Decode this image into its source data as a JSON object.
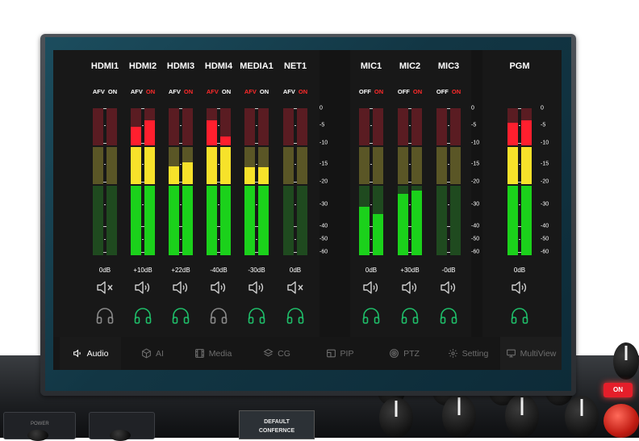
{
  "channels": [
    {
      "name": "HDMI1",
      "t1": "AFV",
      "t1_color": "#ffffff",
      "t2": "ON",
      "t2_color": "#ffffff",
      "db": "0dB",
      "speaker": "speaker-muted-icon",
      "headphone_color": "#8a8a8a",
      "level_l": 0,
      "level_r": 0
    },
    {
      "name": "HDMI2",
      "t1": "AFV",
      "t1_color": "#ffffff",
      "t2": "ON",
      "t2_color": "#ff2a2a",
      "db": "+10dB",
      "speaker": "speaker-on-icon",
      "headphone_color": "#1fbf6a",
      "level_l": 0.875,
      "level_r": 0.918
    },
    {
      "name": "HDMI3",
      "t1": "AFV",
      "t1_color": "#ffffff",
      "t2": "ON",
      "t2_color": "#ff2a2a",
      "db": "+22dB",
      "speaker": "speaker-on-icon",
      "headphone_color": "#1fbf6a",
      "level_l": 0.606,
      "level_r": 0.632
    },
    {
      "name": "HDMI4",
      "t1": "AFV",
      "t1_color": "#ff2a2a",
      "t2": "ON",
      "t2_color": "#ffffff",
      "db": "-40dB",
      "speaker": "speaker-on-icon",
      "headphone_color": "#8a8a8a",
      "level_l": 0.917,
      "level_r": 0.81
    },
    {
      "name": "MEDIA1",
      "t1": "AFV",
      "t1_color": "#ff2a2a",
      "t2": "ON",
      "t2_color": "#ffffff",
      "db": "-30dB",
      "speaker": "speaker-on-icon",
      "headphone_color": "#1fbf6a",
      "level_l": 0.6,
      "level_r": 0.6
    },
    {
      "name": "NET1",
      "t1": "AFV",
      "t1_color": "#ffffff",
      "t2": "ON",
      "t2_color": "#ff2a2a",
      "db": "0dB",
      "speaker": "speaker-muted-icon",
      "headphone_color": "#1fbf6a",
      "level_l": 0,
      "level_r": 0
    },
    {
      "name": "MIC1",
      "t1": "OFF",
      "t1_color": "#ffffff",
      "t2": "ON",
      "t2_color": "#ff2a2a",
      "db": "0dB",
      "speaker": "speaker-on-icon",
      "headphone_color": "#1fbf6a",
      "level_l": 0.33,
      "level_r": 0.28
    },
    {
      "name": "MIC2",
      "t1": "OFF",
      "t1_color": "#ffffff",
      "t2": "ON",
      "t2_color": "#ff2a2a",
      "db": "+30dB",
      "speaker": "speaker-on-icon",
      "headphone_color": "#1fbf6a",
      "level_l": 0.42,
      "level_r": 0.44
    },
    {
      "name": "MIC3",
      "t1": "OFF",
      "t1_color": "#ffffff",
      "t2": "ON",
      "t2_color": "#ff2a2a",
      "db": "-0dB",
      "speaker": "speaker-on-icon",
      "headphone_color": "#1fbf6a",
      "level_l": 0,
      "level_r": 0
    },
    {
      "name": "PGM",
      "t1": "",
      "t1_color": "#ffffff",
      "t2": "",
      "t2_color": "#ffffff",
      "db": "0dB",
      "speaker": "speaker-on-icon",
      "headphone_color": "#1fbf6a",
      "level_l": 0.9,
      "level_r": 0.918
    }
  ],
  "scale_labels": [
    "0",
    "-5",
    "-10",
    "-15",
    "-20",
    "-30",
    "-40",
    "-50",
    "-60"
  ],
  "tabs": [
    {
      "label": "Audio",
      "icon": "speaker-icon",
      "active": true
    },
    {
      "label": "AI",
      "icon": "cube-icon",
      "active": false
    },
    {
      "label": "Media",
      "icon": "film-icon",
      "active": false
    },
    {
      "label": "CG",
      "icon": "layers-icon",
      "active": false
    },
    {
      "label": "PIP",
      "icon": "pip-icon",
      "active": false
    },
    {
      "label": "PTZ",
      "icon": "target-icon",
      "active": false
    },
    {
      "label": "Setting",
      "icon": "gear-icon",
      "active": false
    },
    {
      "label": "MultiView",
      "icon": "monitor-icon",
      "active": false
    }
  ],
  "hardware": {
    "on_button": "ON",
    "lcd_line1": "DEFAULT",
    "lcd_line2": "CONFERNCE",
    "power_label": "POWER"
  },
  "colors": {
    "meter_red": "#ff1f2e",
    "meter_yellow": "#f7e22a",
    "meter_green": "#1bd11b",
    "accent_on": "#ff2a2a",
    "monitor_active": "#1fbf6a"
  }
}
